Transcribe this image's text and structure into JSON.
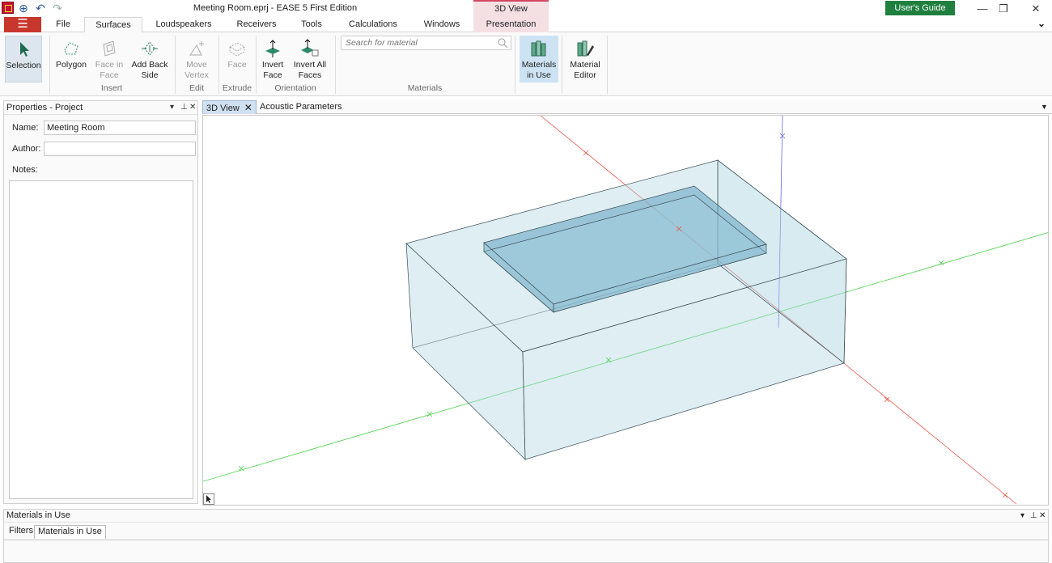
{
  "window": {
    "title": "Meeting Room.eprj - EASE 5 First Edition",
    "context_title": "3D View",
    "users_guide": "User's Guide",
    "minimize": "—",
    "restore": "❐",
    "close": "✕"
  },
  "menu": {
    "button": "☰",
    "tabs": [
      "File",
      "Surfaces",
      "Loudspeakers",
      "Receivers",
      "Tools",
      "Calculations",
      "Windows",
      "Presentation"
    ],
    "active_tab": "Surfaces",
    "collapse": "⌄"
  },
  "ribbon": {
    "selection": "Selection",
    "polygon": "Polygon",
    "face_in_face": [
      "Face in",
      "Face"
    ],
    "add_back_side": [
      "Add Back",
      "Side"
    ],
    "move_vertex": [
      "Move",
      "Vertex"
    ],
    "face": "Face",
    "invert_face": [
      "Invert",
      "Face"
    ],
    "invert_all_faces": [
      "Invert All",
      "Faces"
    ],
    "search_placeholder": "Search for material",
    "materials_in_use": [
      "Materials",
      "in Use"
    ],
    "material_editor": [
      "Material",
      "Editor"
    ],
    "groups": {
      "insert": "Insert",
      "edit": "Edit",
      "extrude": "Extrude",
      "orientation": "Orientation",
      "materials": "Materials"
    }
  },
  "properties": {
    "title": "Properties - Project",
    "name_label": "Name:",
    "name_value": "Meeting Room",
    "author_label": "Author:",
    "author_value": "",
    "notes_label": "Notes:",
    "dropdown": "▾",
    "pin": "⊥",
    "close": "✕"
  },
  "view_tabs": {
    "tab_3d": "3D View",
    "tab_close": "✕",
    "tab_acoustic": "Acoustic Parameters",
    "menu": "▼"
  },
  "bottom_panel": {
    "title": "Materials in Use",
    "tabs": [
      "Filters",
      "Materials in Use"
    ],
    "active_tab": "Materials in Use",
    "dropdown": "▾",
    "pin": "⊥",
    "close": "✕"
  },
  "colors": {
    "accent_red": "#c8372d",
    "context_pink": "#f4dfe3",
    "guide_green": "#1e7f3e",
    "room_fill": "#a9d3e0",
    "axis_x": "#e8574a",
    "axis_y": "#4ad24a",
    "axis_z": "#6a6af0"
  }
}
